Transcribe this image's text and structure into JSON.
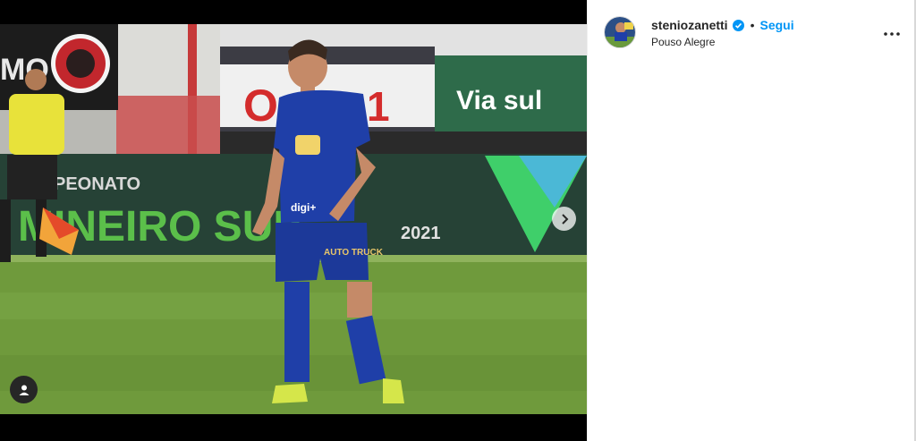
{
  "post": {
    "username": "steniozanetti",
    "separator": "•",
    "follow_label": "Segui",
    "location": "Pouso Alegre",
    "verified_icon": "verified-badge-icon",
    "more_icon": "more-options-icon",
    "next_icon": "chevron-right-icon",
    "tag_icon": "user-tag-icon"
  },
  "photo": {
    "banner_text_1": "PEONATO",
    "banner_text_2": "MINEIRO SUB",
    "banner_year": "2021",
    "sponsor_text": "Via sul",
    "jersey_sponsor": "digi+",
    "shorts_sponsor": "AUTO TRUCK"
  },
  "colors": {
    "follow": "#0095f6",
    "jersey": "#1f3fa8",
    "pitch": "#6f9a3c"
  }
}
